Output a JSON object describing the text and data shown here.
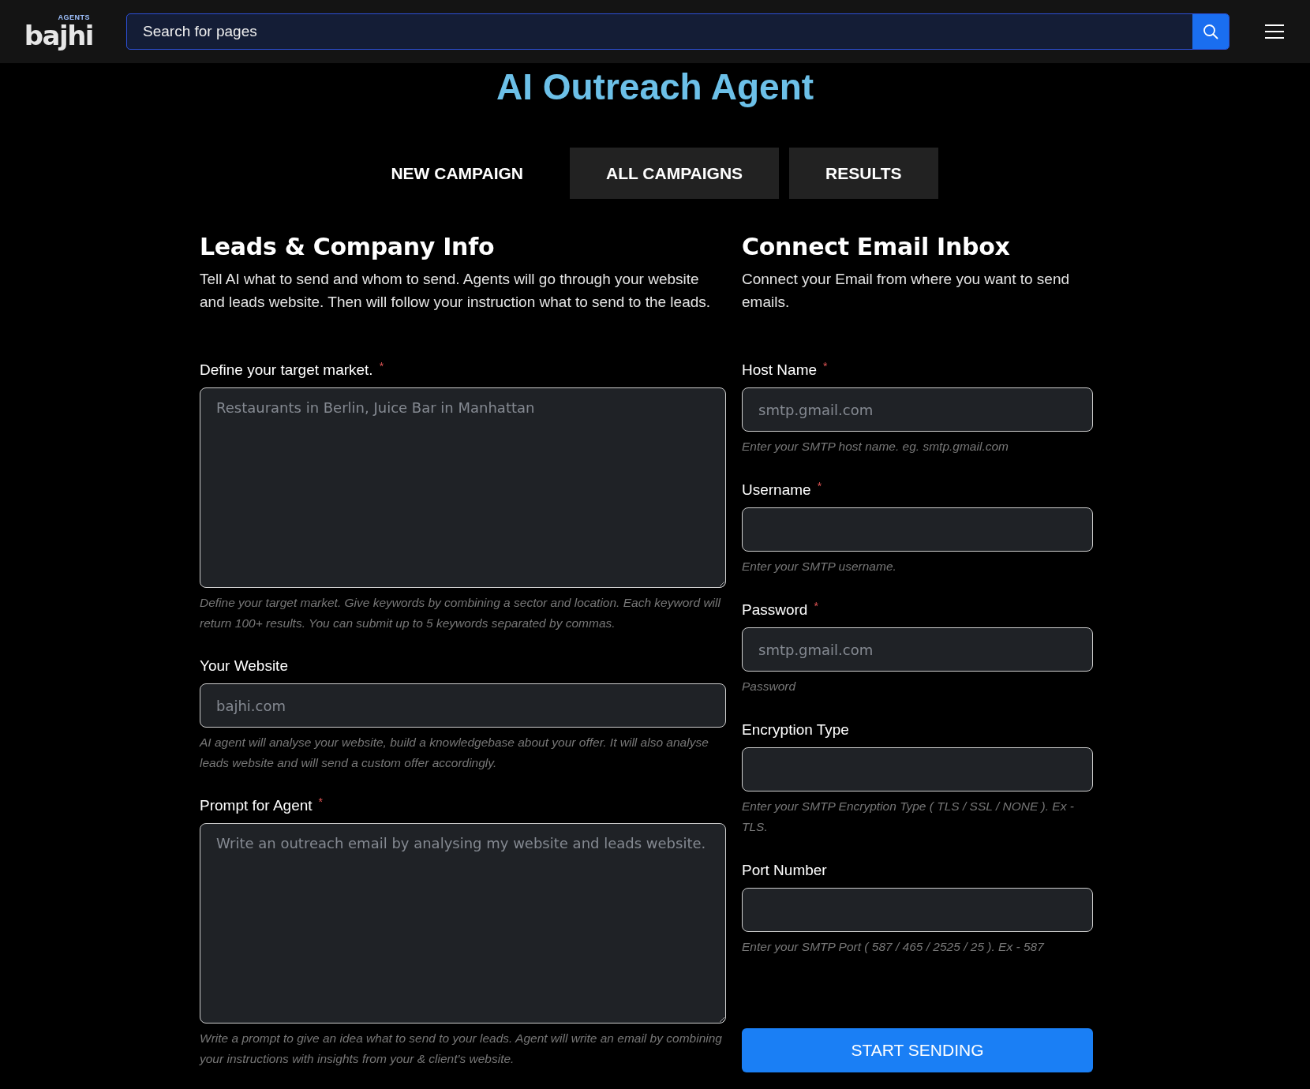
{
  "header": {
    "logo": {
      "tag": "AGENTS",
      "name": "bajhi"
    },
    "search": {
      "placeholder": "Search for pages"
    }
  },
  "page_title": "AI Outreach Agent",
  "tabs": [
    {
      "label": "NEW CAMPAIGN",
      "selected": true
    },
    {
      "label": "ALL CAMPAIGNS",
      "selected": false
    },
    {
      "label": "RESULTS",
      "selected": false
    }
  ],
  "left": {
    "heading": "Leads & Company Info",
    "description": "Tell AI what to send and whom to send. Agents will go through your website and leads website. Then will follow your instruction what to send to the leads.",
    "fields": [
      {
        "kind": "textarea",
        "label": "Define your target market.",
        "required_mark": "*",
        "placeholder": "Restaurants in Berlin, Juice Bar in Manhattan",
        "help": "Define your target market. Give keywords by combining a sector and location. Each keyword will return 100+ results. You can submit up to 5 keywords separated by commas."
      },
      {
        "kind": "input",
        "label": "Your Website",
        "placeholder": "bajhi.com",
        "help": "AI agent will analyse your website, build a knowledgebase about your offer. It will also analyse leads website and will send a custom offer accordingly."
      },
      {
        "kind": "textarea",
        "label": "Prompt for Agent",
        "required_mark": "*",
        "placeholder": "Write an outreach email by analysing my website and leads website.",
        "help": "Write a prompt to give an idea what to send to your leads. Agent will write an email by combining your instructions with insights from your & client's website."
      }
    ]
  },
  "right": {
    "heading": "Connect Email Inbox",
    "description": "Connect your Email from where you want to send emails.",
    "fields": [
      {
        "kind": "input",
        "label": "Host Name",
        "required_mark": "*",
        "placeholder": "smtp.gmail.com",
        "help": "Enter your SMTP host name. eg. smtp.gmail.com"
      },
      {
        "kind": "input",
        "label": "Username",
        "required_mark": "*",
        "help": "Enter your SMTP username."
      },
      {
        "kind": "input",
        "label": "Password",
        "required_mark": "*",
        "placeholder": "smtp.gmail.com",
        "help": "Password"
      },
      {
        "kind": "input",
        "label": "Encryption Type",
        "help": "Enter your SMTP Encryption Type ( TLS / SSL / NONE ). Ex - TLS."
      },
      {
        "kind": "input",
        "label": "Port Number",
        "help": "Enter your SMTP Port ( 587 / 465 / 2525 / 25 ). Ex - 587"
      }
    ],
    "submit": "START SENDING"
  }
}
